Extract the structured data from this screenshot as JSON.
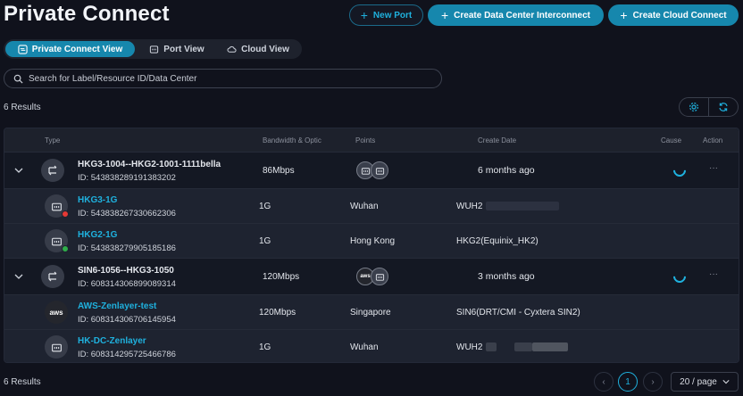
{
  "header": {
    "title": "Private Connect",
    "buttons": {
      "new_port": "New Port",
      "create_dci": "Create Data Center Interconnect",
      "create_cloud": "Create Cloud Connect"
    }
  },
  "views": {
    "private_connect": "Private Connect View",
    "port": "Port View",
    "cloud": "Cloud View",
    "active": "Private Connect View"
  },
  "search": {
    "placeholder": "Search for Label/Resource ID/Data Center"
  },
  "results_top": "6 Results",
  "results_bottom": "6 Results",
  "table": {
    "headers": {
      "type": "Type",
      "bandwidth": "Bandwidth & Optic",
      "points": "Points",
      "create_date": "Create Date",
      "cause": "Cause",
      "action": "Action"
    },
    "groups": [
      {
        "name": "HKG3-1004--HKG2-1001-1111bella",
        "id": "ID: 543838289191383202",
        "bandwidth": "86Mbps",
        "create_date": "6 months ago",
        "point_icons": [
          "port-icon",
          "port-icon"
        ],
        "children": [
          {
            "name": "HKG3-1G",
            "id": "ID: 543838267330662306",
            "bandwidth": "1G",
            "point": "Wuhan",
            "dc": "WUH2",
            "status_color": "#e53935"
          },
          {
            "name": "HKG2-1G",
            "id": "ID: 543838279905185186",
            "bandwidth": "1G",
            "point": "Hong Kong",
            "dc": "HKG2(Equinix_HK2)",
            "status_color": "#2fae4a"
          }
        ]
      },
      {
        "name": "SIN6-1056--HKG3-1050",
        "id": "ID: 608314306899089314",
        "bandwidth": "120Mbps",
        "create_date": "3 months ago",
        "point_icons": [
          "aws-icon",
          "port-icon"
        ],
        "children": [
          {
            "name": "AWS-Zenlayer-test",
            "id": "ID: 608314306706145954",
            "bandwidth": "120Mbps",
            "point": "Singapore",
            "dc": "SIN6(DRT/CMI - Cyxtera SIN2)",
            "avatar_label": "aws"
          },
          {
            "name": "HK-DC-Zenlayer",
            "id": "ID: 608314295725466786",
            "bandwidth": "1G",
            "point": "Wuhan",
            "dc": "WUH2"
          }
        ]
      }
    ]
  },
  "pagination": {
    "current_page": "1",
    "page_size": "20 / page"
  },
  "colors": {
    "accent": "#1fb1de",
    "primary_button": "#1687ad",
    "background": "#10121c"
  }
}
